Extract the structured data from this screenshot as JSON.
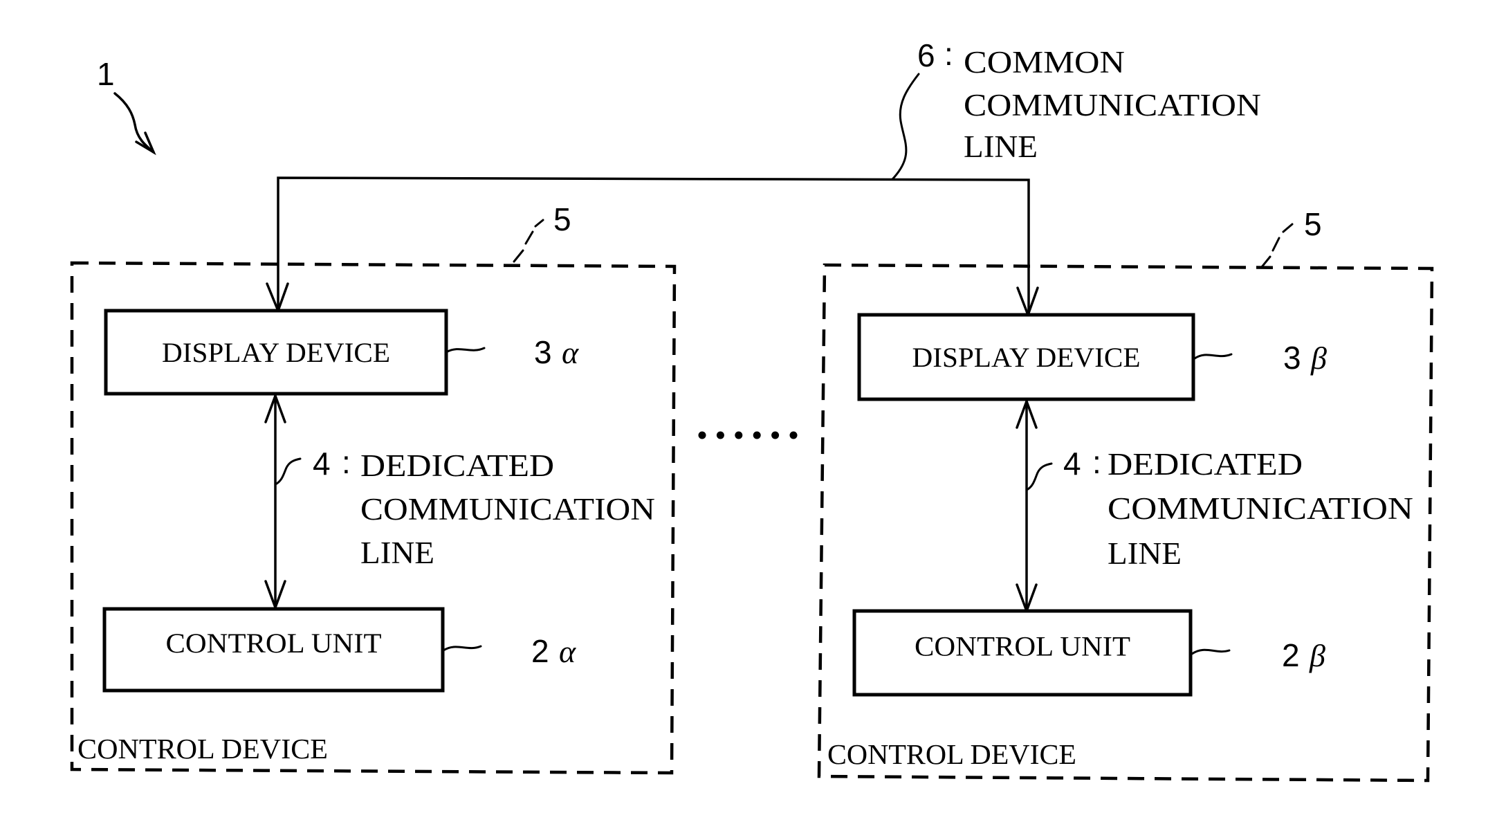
{
  "figure": {
    "system_ref": "1",
    "common_line": {
      "ref": "6",
      "separator": ":",
      "label_lines": [
        "COMMON",
        "COMMUNICATION",
        "LINE"
      ]
    },
    "ellipsis": "......",
    "control_devices": [
      {
        "group_ref": "5",
        "caption": "CONTROL DEVICE",
        "display_device": {
          "label": "DISPLAY DEVICE",
          "ref_num": "3",
          "ref_greek": "α"
        },
        "control_unit": {
          "label": "CONTROL UNIT",
          "ref_num": "2",
          "ref_greek": "α"
        },
        "dedicated_line": {
          "ref": "4",
          "separator": ":",
          "label_lines": [
            "DEDICATED",
            "COMMUNICATION",
            "LINE"
          ]
        }
      },
      {
        "group_ref": "5",
        "caption": "CONTROL DEVICE",
        "display_device": {
          "label": "DISPLAY DEVICE",
          "ref_num": "3",
          "ref_greek": "β"
        },
        "control_unit": {
          "label": "CONTROL UNIT",
          "ref_num": "2",
          "ref_greek": "β"
        },
        "dedicated_line": {
          "ref": "4",
          "separator": ":",
          "label_lines": [
            "DEDICATED",
            "COMMUNICATION",
            "LINE"
          ]
        }
      }
    ]
  }
}
